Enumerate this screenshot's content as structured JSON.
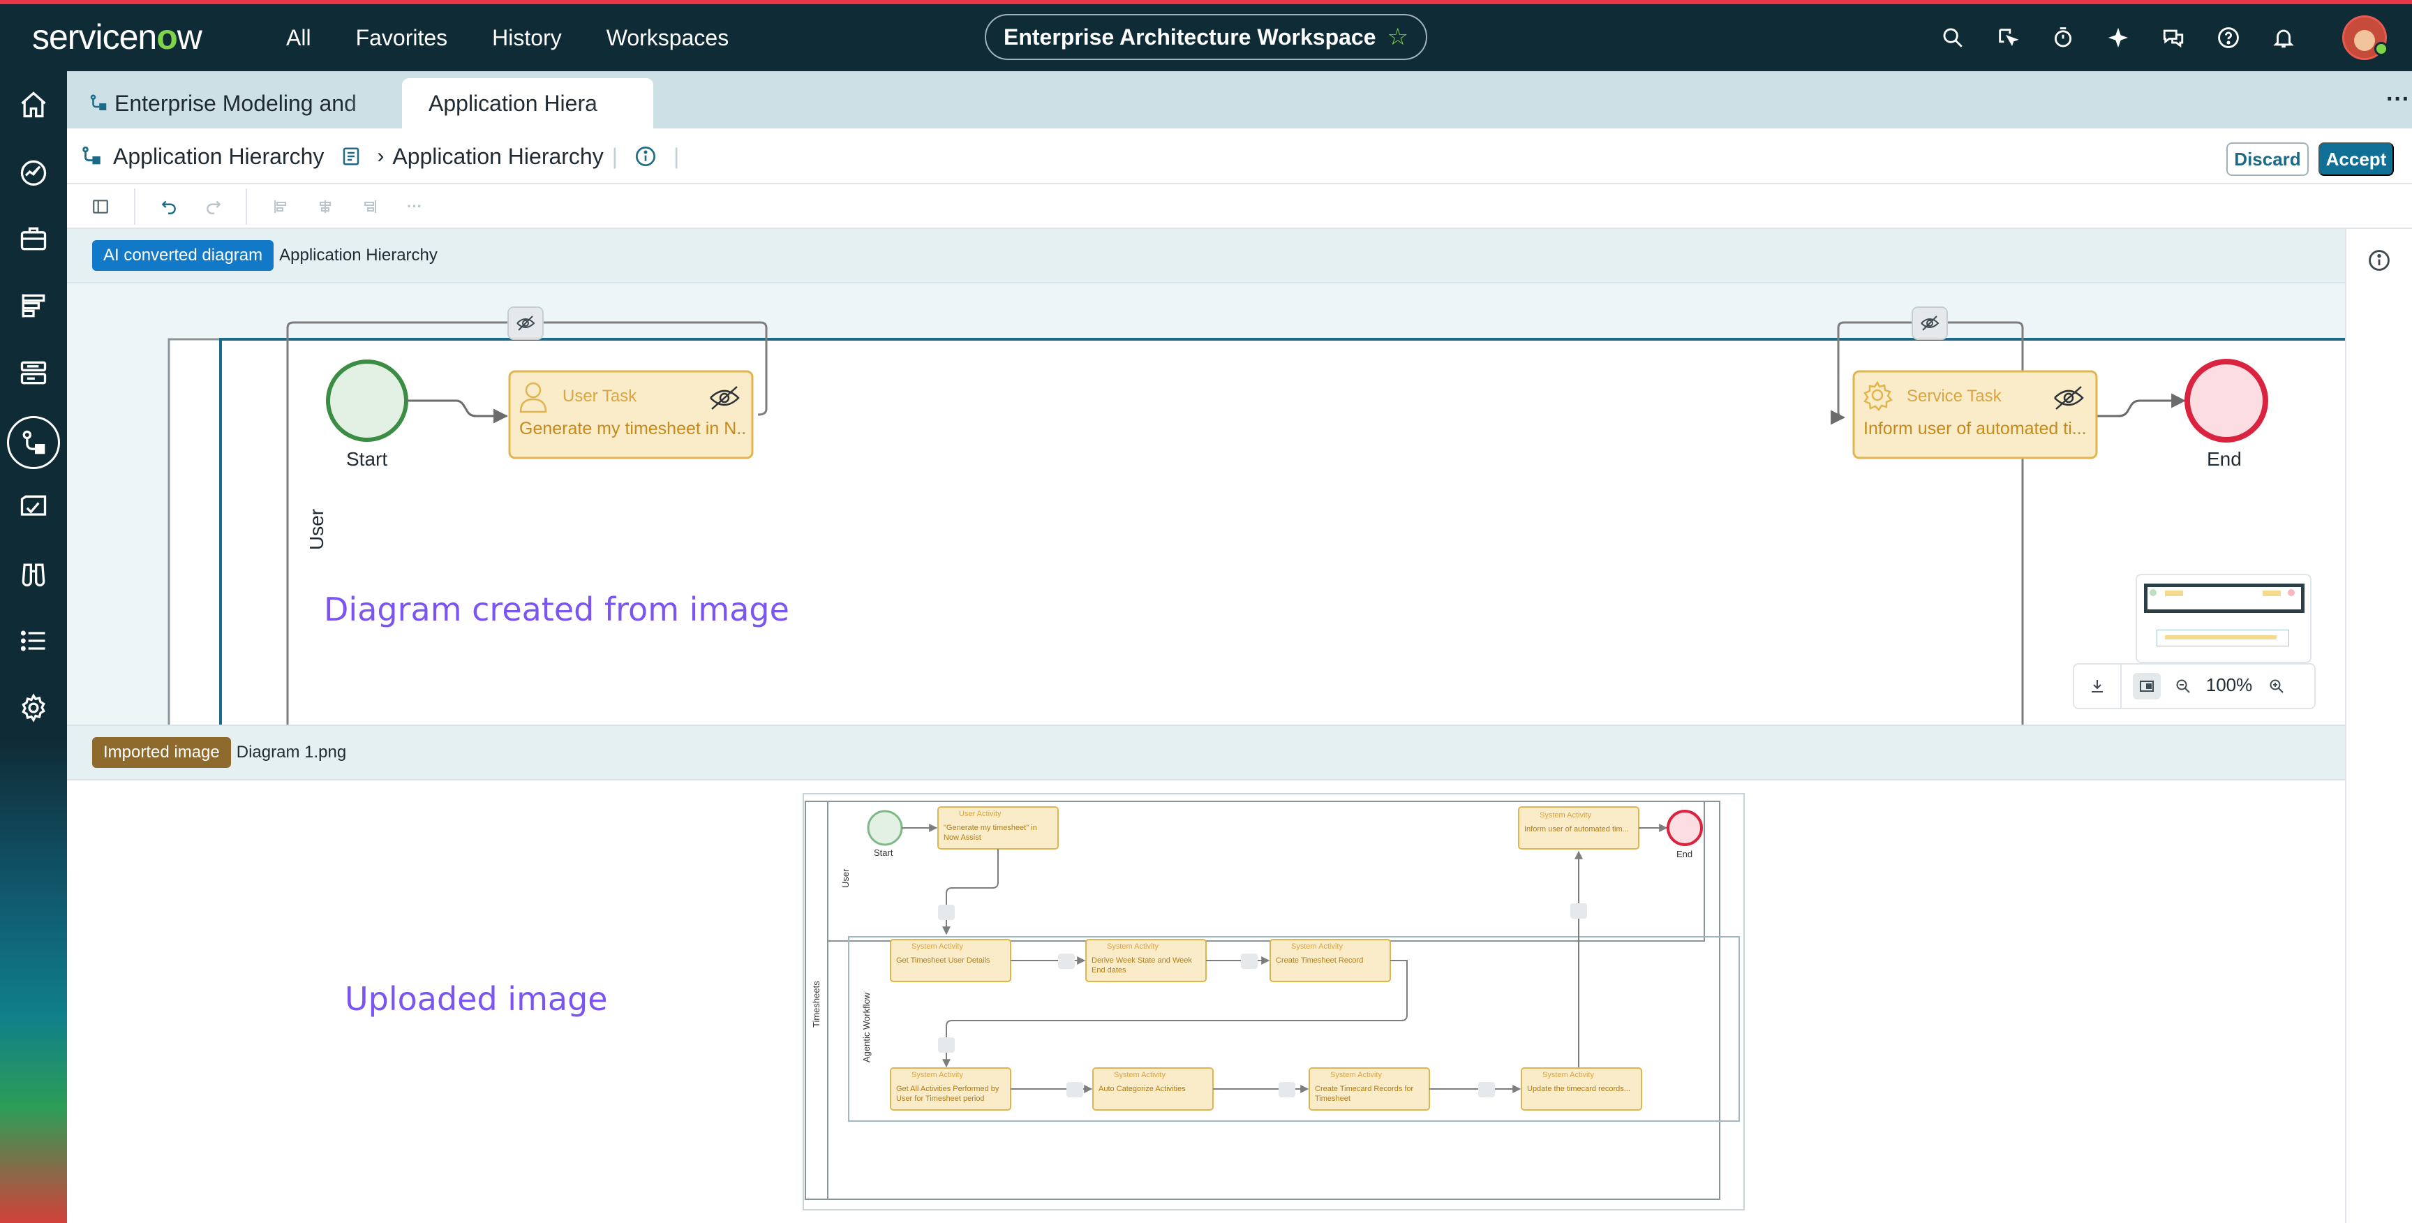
{
  "app": {
    "logo_text": "servicenow",
    "brand_colors": {
      "topbar": "#0f2b36",
      "accent": "#7fd44a",
      "primary": "#0f6f94"
    }
  },
  "topnav": {
    "items": [
      "All",
      "Favorites",
      "History",
      "Workspaces"
    ],
    "workspace_title": "Enterprise Architecture Workspace",
    "icons": [
      "search-icon",
      "select-icon",
      "timer-icon",
      "sparkle-icon",
      "chat-icon",
      "help-icon",
      "bell-icon",
      "user-avatar"
    ]
  },
  "sidebar": {
    "icons": [
      "home-icon",
      "dashboard-icon",
      "briefcase-icon",
      "reports-icon",
      "list-view-icon",
      "diagram-icon",
      "inspection-icon",
      "binoculars-icon",
      "list-icon",
      "settings-icon"
    ],
    "active": "diagram-icon"
  },
  "tabs": [
    {
      "label": "Enterprise Modeling and",
      "active": false
    },
    {
      "label": "Application Hiera",
      "active": true
    }
  ],
  "header": {
    "crumb_1": "Application Hierarchy",
    "crumb_2": "Application Hierarchy",
    "discard_label": "Discard",
    "accept_label": "Accept"
  },
  "ai_banner": {
    "tag": "AI converted diagram",
    "name": "Application Hierarchy"
  },
  "diagram": {
    "lane_label": "User",
    "start_label": "Start",
    "end_label": "End",
    "user_task_type": "User Task",
    "user_task_text": "Generate my timesheet in N...",
    "service_task_type": "Service Task",
    "service_task_text": "Inform user of automated ti...",
    "annotation": "Diagram created from image"
  },
  "zoom": {
    "level": "100%"
  },
  "import_banner": {
    "tag": "Imported image",
    "name": "Diagram 1.png"
  },
  "uploaded": {
    "annotation": "Uploaded image",
    "pool_label": "Timesheets",
    "lane_user": "User",
    "lane_agentic": "Agentic Workflow",
    "start": "Start",
    "end": "End",
    "user_activity_type": "User Activity",
    "user_activity_text_1": "\"Generate my timesheet\" in",
    "user_activity_text_2": "Now Assist",
    "system_type": "System Activity",
    "inform_text": "Inform user of automated tim...",
    "act_get_user": "Get Timesheet User Details",
    "act_derive_1": "Derive Week State and Week",
    "act_derive_2": "End dates",
    "act_create": "Create Timesheet Record",
    "act_get_all_1": "Get All Activities Performed by",
    "act_get_all_2": "User for Timesheet period",
    "act_auto": "Auto Categorize Activities",
    "act_timecard_1": "Create Timecard Records for",
    "act_timecard_2": "Timesheet",
    "act_update": "Update the timecard records..."
  }
}
